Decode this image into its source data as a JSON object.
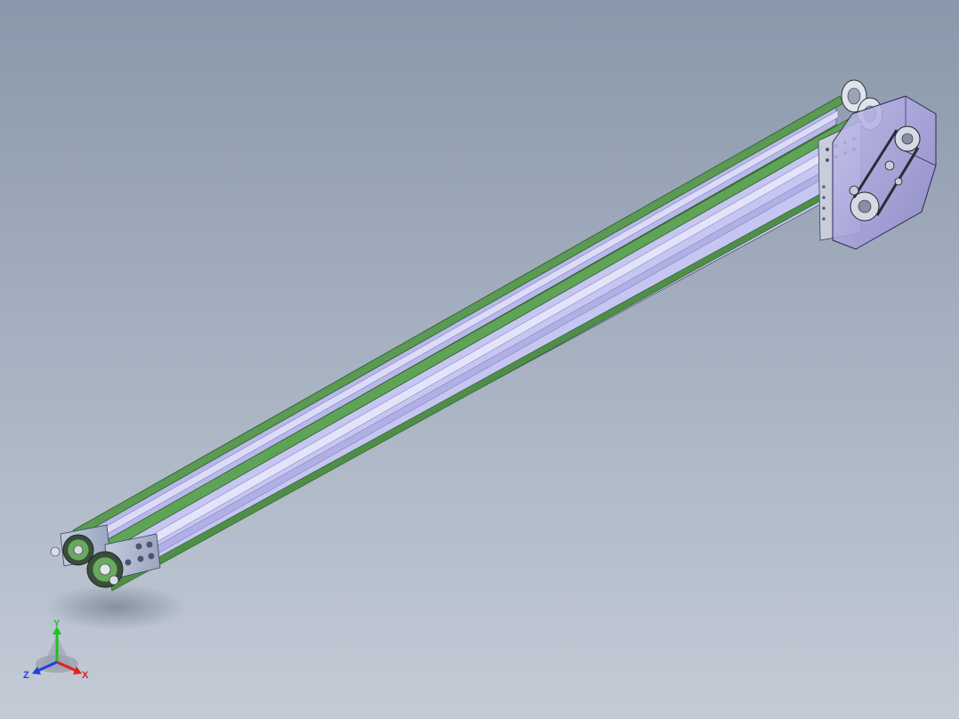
{
  "viewport": {
    "background_top": "#8a98ab",
    "background_bottom": "#c3cbd6"
  },
  "model": {
    "belt_color": "#5a9a52",
    "frame_color": "#c9c9f2",
    "housing_color": "#a9a3dd",
    "metal_color": "#b9c6d9"
  },
  "triad": {
    "x_label": "X",
    "y_label": "Y",
    "z_label": "Z",
    "x_color": "#e02020",
    "y_color": "#20c020",
    "z_color": "#2040e0"
  }
}
